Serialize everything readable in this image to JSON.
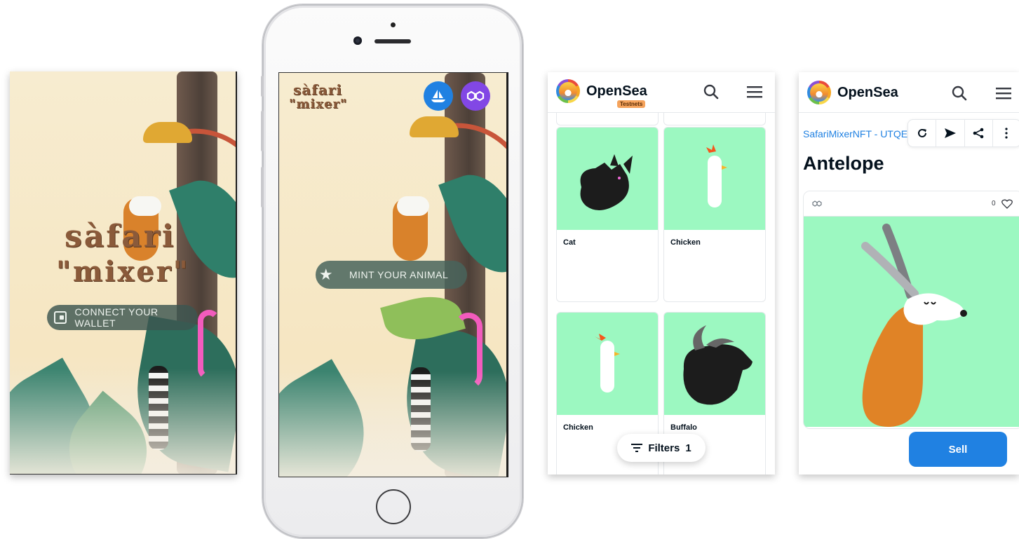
{
  "screen1": {
    "logo_line1": "sàfari",
    "logo_line2": "\"mixer\"",
    "connect_button": "CONNECT YOUR WALLET"
  },
  "screen2": {
    "logo_line1": "sàfari",
    "logo_line2": "\"mixer\"",
    "mint_button": "MINT YOUR ANIMAL",
    "opensea_icon": "opensea-sailboat-icon",
    "polygon_icon": "polygon-icon"
  },
  "colors": {
    "opensea_blue": "#2081e2",
    "polygon_purple": "#8247e5",
    "nft_bg": "#9cf8c1",
    "testnets_badge": "#f5a35c"
  },
  "opensea_list": {
    "brand": "OpenSea",
    "badge": "Testnets",
    "items": [
      {
        "name": "Cat"
      },
      {
        "name": "Chicken"
      },
      {
        "name": "Chicken"
      },
      {
        "name": "Buffalo"
      }
    ],
    "filters_label": "Filters",
    "filters_count": "1"
  },
  "opensea_detail": {
    "brand": "OpenSea",
    "collection": "SafariMixerNFT - UTQE",
    "title": "Antelope",
    "likes": "0",
    "sell_label": "Sell"
  }
}
